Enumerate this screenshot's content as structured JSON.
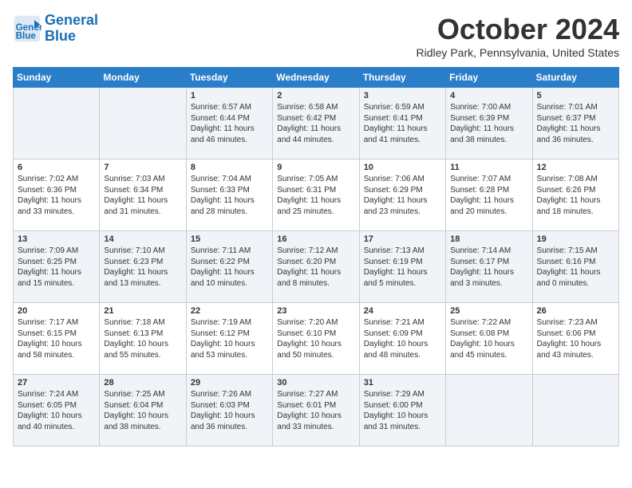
{
  "header": {
    "logo_line1": "General",
    "logo_line2": "Blue",
    "month_title": "October 2024",
    "subtitle": "Ridley Park, Pennsylvania, United States"
  },
  "days_of_week": [
    "Sunday",
    "Monday",
    "Tuesday",
    "Wednesday",
    "Thursday",
    "Friday",
    "Saturday"
  ],
  "weeks": [
    [
      {
        "num": "",
        "info": ""
      },
      {
        "num": "",
        "info": ""
      },
      {
        "num": "1",
        "info": "Sunrise: 6:57 AM\nSunset: 6:44 PM\nDaylight: 11 hours and 46 minutes."
      },
      {
        "num": "2",
        "info": "Sunrise: 6:58 AM\nSunset: 6:42 PM\nDaylight: 11 hours and 44 minutes."
      },
      {
        "num": "3",
        "info": "Sunrise: 6:59 AM\nSunset: 6:41 PM\nDaylight: 11 hours and 41 minutes."
      },
      {
        "num": "4",
        "info": "Sunrise: 7:00 AM\nSunset: 6:39 PM\nDaylight: 11 hours and 38 minutes."
      },
      {
        "num": "5",
        "info": "Sunrise: 7:01 AM\nSunset: 6:37 PM\nDaylight: 11 hours and 36 minutes."
      }
    ],
    [
      {
        "num": "6",
        "info": "Sunrise: 7:02 AM\nSunset: 6:36 PM\nDaylight: 11 hours and 33 minutes."
      },
      {
        "num": "7",
        "info": "Sunrise: 7:03 AM\nSunset: 6:34 PM\nDaylight: 11 hours and 31 minutes."
      },
      {
        "num": "8",
        "info": "Sunrise: 7:04 AM\nSunset: 6:33 PM\nDaylight: 11 hours and 28 minutes."
      },
      {
        "num": "9",
        "info": "Sunrise: 7:05 AM\nSunset: 6:31 PM\nDaylight: 11 hours and 25 minutes."
      },
      {
        "num": "10",
        "info": "Sunrise: 7:06 AM\nSunset: 6:29 PM\nDaylight: 11 hours and 23 minutes."
      },
      {
        "num": "11",
        "info": "Sunrise: 7:07 AM\nSunset: 6:28 PM\nDaylight: 11 hours and 20 minutes."
      },
      {
        "num": "12",
        "info": "Sunrise: 7:08 AM\nSunset: 6:26 PM\nDaylight: 11 hours and 18 minutes."
      }
    ],
    [
      {
        "num": "13",
        "info": "Sunrise: 7:09 AM\nSunset: 6:25 PM\nDaylight: 11 hours and 15 minutes."
      },
      {
        "num": "14",
        "info": "Sunrise: 7:10 AM\nSunset: 6:23 PM\nDaylight: 11 hours and 13 minutes."
      },
      {
        "num": "15",
        "info": "Sunrise: 7:11 AM\nSunset: 6:22 PM\nDaylight: 11 hours and 10 minutes."
      },
      {
        "num": "16",
        "info": "Sunrise: 7:12 AM\nSunset: 6:20 PM\nDaylight: 11 hours and 8 minutes."
      },
      {
        "num": "17",
        "info": "Sunrise: 7:13 AM\nSunset: 6:19 PM\nDaylight: 11 hours and 5 minutes."
      },
      {
        "num": "18",
        "info": "Sunrise: 7:14 AM\nSunset: 6:17 PM\nDaylight: 11 hours and 3 minutes."
      },
      {
        "num": "19",
        "info": "Sunrise: 7:15 AM\nSunset: 6:16 PM\nDaylight: 11 hours and 0 minutes."
      }
    ],
    [
      {
        "num": "20",
        "info": "Sunrise: 7:17 AM\nSunset: 6:15 PM\nDaylight: 10 hours and 58 minutes."
      },
      {
        "num": "21",
        "info": "Sunrise: 7:18 AM\nSunset: 6:13 PM\nDaylight: 10 hours and 55 minutes."
      },
      {
        "num": "22",
        "info": "Sunrise: 7:19 AM\nSunset: 6:12 PM\nDaylight: 10 hours and 53 minutes."
      },
      {
        "num": "23",
        "info": "Sunrise: 7:20 AM\nSunset: 6:10 PM\nDaylight: 10 hours and 50 minutes."
      },
      {
        "num": "24",
        "info": "Sunrise: 7:21 AM\nSunset: 6:09 PM\nDaylight: 10 hours and 48 minutes."
      },
      {
        "num": "25",
        "info": "Sunrise: 7:22 AM\nSunset: 6:08 PM\nDaylight: 10 hours and 45 minutes."
      },
      {
        "num": "26",
        "info": "Sunrise: 7:23 AM\nSunset: 6:06 PM\nDaylight: 10 hours and 43 minutes."
      }
    ],
    [
      {
        "num": "27",
        "info": "Sunrise: 7:24 AM\nSunset: 6:05 PM\nDaylight: 10 hours and 40 minutes."
      },
      {
        "num": "28",
        "info": "Sunrise: 7:25 AM\nSunset: 6:04 PM\nDaylight: 10 hours and 38 minutes."
      },
      {
        "num": "29",
        "info": "Sunrise: 7:26 AM\nSunset: 6:03 PM\nDaylight: 10 hours and 36 minutes."
      },
      {
        "num": "30",
        "info": "Sunrise: 7:27 AM\nSunset: 6:01 PM\nDaylight: 10 hours and 33 minutes."
      },
      {
        "num": "31",
        "info": "Sunrise: 7:29 AM\nSunset: 6:00 PM\nDaylight: 10 hours and 31 minutes."
      },
      {
        "num": "",
        "info": ""
      },
      {
        "num": "",
        "info": ""
      }
    ]
  ]
}
